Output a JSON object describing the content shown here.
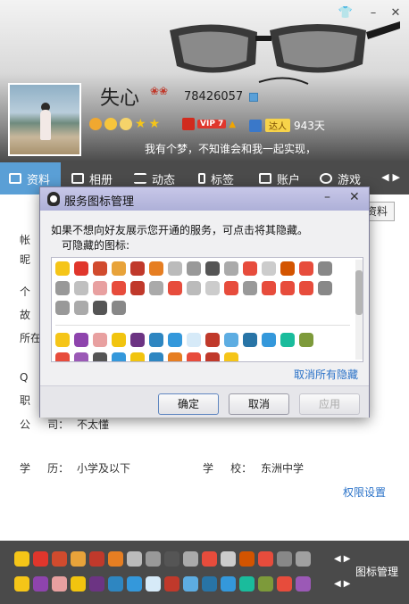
{
  "profile": {
    "nickname": "失心",
    "qq_number": "78426057",
    "vip_tag": "VIP 7",
    "daren_tag": "达人",
    "active_days": "943天",
    "signature": "我有个梦，不知谁会和我一起实现，"
  },
  "tabs": [
    {
      "label": "资料"
    },
    {
      "label": "相册"
    },
    {
      "label": "动态"
    },
    {
      "label": "标签"
    },
    {
      "label": "账户"
    },
    {
      "label": "游戏"
    }
  ],
  "fields": {
    "edit_label": "资料",
    "account_label": "帐",
    "nick_label": "昵",
    "gender_label": "个",
    "hometown_label": "故",
    "location_label": "所在",
    "q_label": "Q",
    "job_label": "职",
    "company_label": "公     司：",
    "company_value": "不太懂",
    "education_label": "学     历：",
    "education_value": "小学及以下",
    "school_label": "学     校：",
    "school_value": "东洲中学"
  },
  "permission_link": "权限设置",
  "bottom_bar": {
    "manage_label": "图标管理"
  },
  "modal": {
    "title": "服务图标管理",
    "description": "如果不想向好友展示您开通的服务，可点击将其隐藏。",
    "subheading": "可隐藏的图标:",
    "unhide_all": "取消所有隐藏",
    "ok": "确定",
    "cancel": "取消",
    "apply": "应用"
  },
  "colors": {
    "accent_blue": "#5a9fd6",
    "link_blue": "#2a72c8",
    "dark_bar": "#4a4a4a",
    "modal_title": "#aeb0d8"
  }
}
